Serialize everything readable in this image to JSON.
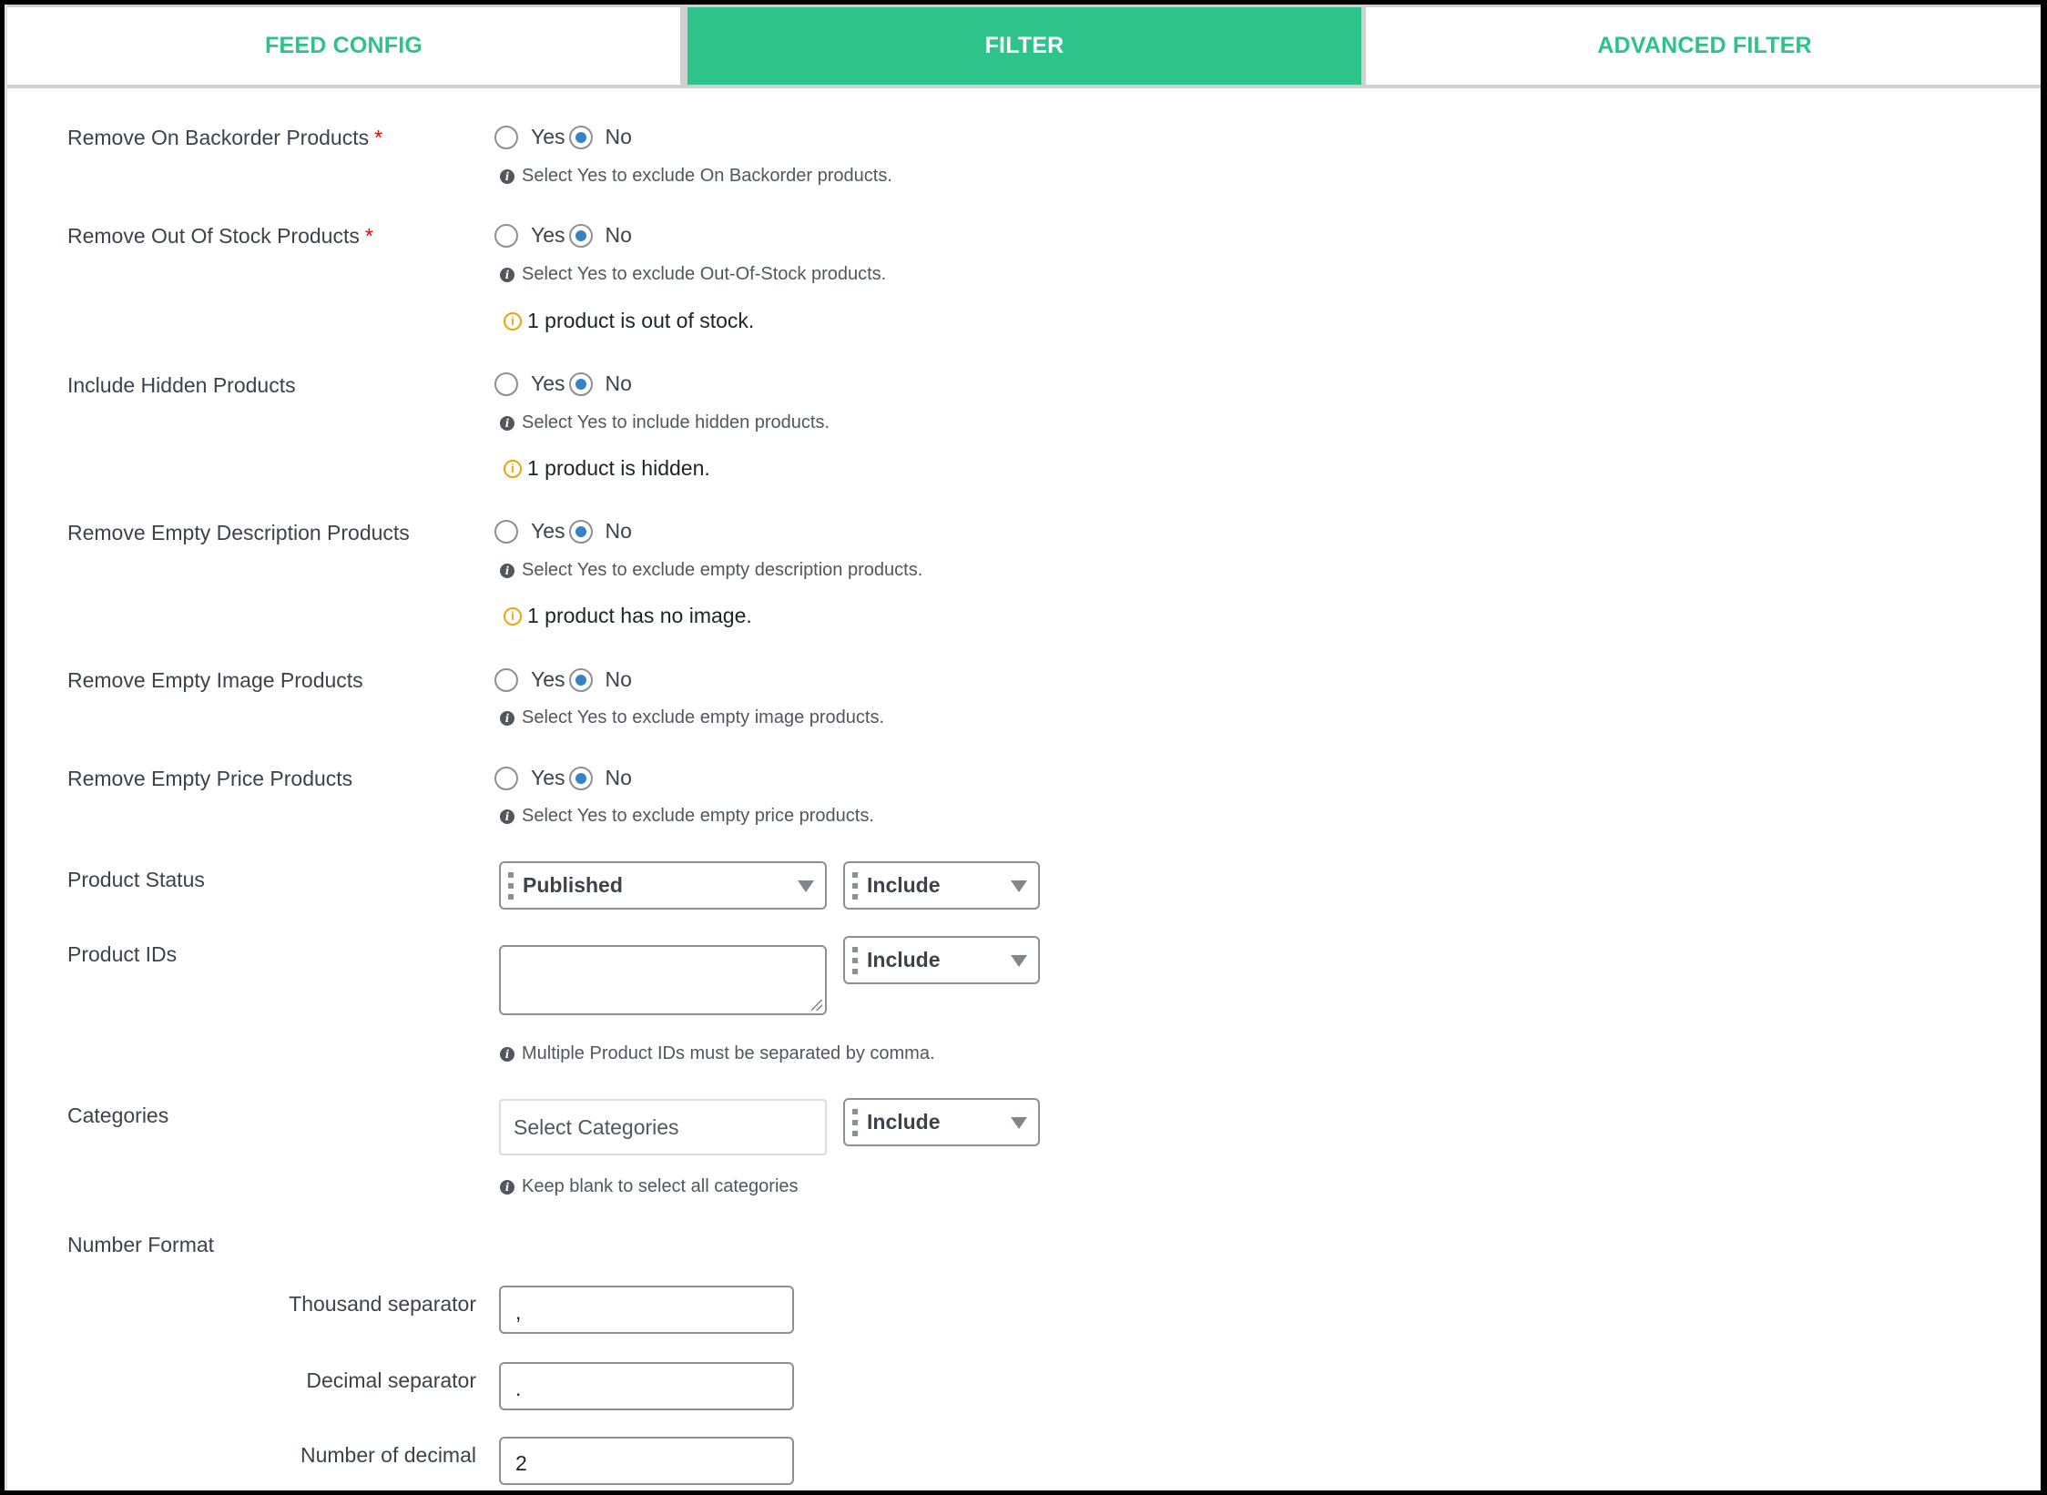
{
  "tabs": [
    {
      "label": "FEED CONFIG",
      "active": false
    },
    {
      "label": "FILTER",
      "active": true
    },
    {
      "label": "ADVANCED FILTER",
      "active": false
    }
  ],
  "colors": {
    "accent": "#2dc38a",
    "radio_selected": "#3582c4",
    "required": "#ee0000",
    "notice": "#f0a30a"
  },
  "options": {
    "yes": "Yes",
    "no": "No"
  },
  "filters": [
    {
      "label": "Remove On Backorder Products",
      "required": "*",
      "selected": "No",
      "help": "Select Yes to exclude On Backorder products."
    },
    {
      "label": "Remove Out Of Stock Products",
      "required": "*",
      "selected": "No",
      "help": "Select Yes to exclude Out-Of-Stock products.",
      "notice": "1 product is out of stock."
    },
    {
      "label": "Include Hidden Products",
      "selected": "No",
      "help": "Select Yes to include hidden products.",
      "notice": "1 product is hidden."
    },
    {
      "label": "Remove Empty Description Products",
      "selected": "No",
      "help": "Select Yes to exclude empty description products.",
      "notice": "1 product has no image."
    },
    {
      "label": "Remove Empty Image Products",
      "selected": "No",
      "help": "Select Yes to exclude empty image products."
    },
    {
      "label": "Remove Empty Price Products",
      "selected": "No",
      "help": "Select Yes to exclude empty price products."
    }
  ],
  "product_status": {
    "label": "Product Status",
    "value": "Published",
    "mode": "Include"
  },
  "product_ids": {
    "label": "Product IDs",
    "value": "",
    "mode": "Include",
    "help": "Multiple Product IDs must be separated by comma."
  },
  "categories": {
    "label": "Categories",
    "placeholder": "Select Categories",
    "mode": "Include",
    "help": "Keep blank to select all categories"
  },
  "number_format": {
    "label": "Number Format",
    "thousand_separator": {
      "label": "Thousand separator",
      "value": ","
    },
    "decimal_separator": {
      "label": "Decimal separator",
      "value": "."
    },
    "number_of_decimal": {
      "label": "Number of decimal",
      "value": "2"
    }
  },
  "icons": {
    "help": "info-icon",
    "notice": "warning-info-icon",
    "dropdown": "caret-down-icon",
    "drag": "drag-handle-icon"
  }
}
